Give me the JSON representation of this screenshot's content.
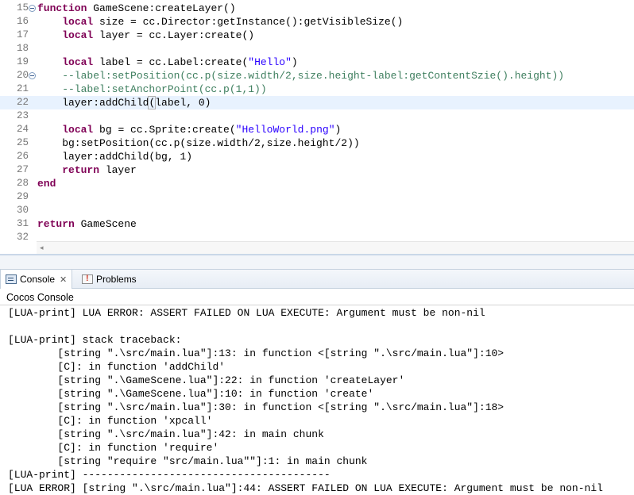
{
  "editor": {
    "lines": [
      {
        "num": "15",
        "fold": true,
        "tokens": [
          {
            "t": "function",
            "c": "kw"
          },
          {
            "t": " GameScene:createLayer()",
            "c": ""
          }
        ]
      },
      {
        "num": "16",
        "fold": false,
        "tokens": [
          {
            "t": "    ",
            "c": ""
          },
          {
            "t": "local",
            "c": "kw"
          },
          {
            "t": " size = cc.Director:getInstance():getVisibleSize()",
            "c": ""
          }
        ]
      },
      {
        "num": "17",
        "fold": false,
        "tokens": [
          {
            "t": "    ",
            "c": ""
          },
          {
            "t": "local",
            "c": "kw"
          },
          {
            "t": " layer = cc.Layer:create()",
            "c": ""
          }
        ]
      },
      {
        "num": "18",
        "fold": false,
        "tokens": []
      },
      {
        "num": "19",
        "fold": false,
        "tokens": [
          {
            "t": "    ",
            "c": ""
          },
          {
            "t": "local",
            "c": "kw"
          },
          {
            "t": " label = cc.Label:create(",
            "c": ""
          },
          {
            "t": "\"Hello\"",
            "c": "str"
          },
          {
            "t": ")",
            "c": ""
          }
        ]
      },
      {
        "num": "20",
        "fold": true,
        "tokens": [
          {
            "t": "    --label:setPosition(cc.p(size.width/2,size.height-label:getContentSzie().height))",
            "c": "cmt"
          }
        ]
      },
      {
        "num": "21",
        "fold": false,
        "tokens": [
          {
            "t": "    --label:setAnchorPoint(cc.p(1,1))",
            "c": "cmt"
          }
        ]
      },
      {
        "num": "22",
        "fold": false,
        "current": true,
        "tokens": [
          {
            "t": "    layer:addChild",
            "c": ""
          },
          {
            "t": "(",
            "c": "bracket"
          },
          {
            "t": "label, ",
            "c": ""
          },
          {
            "t": "0",
            "c": "num"
          },
          {
            "t": ")",
            "c": ""
          }
        ]
      },
      {
        "num": "23",
        "fold": false,
        "tokens": []
      },
      {
        "num": "24",
        "fold": false,
        "tokens": [
          {
            "t": "    ",
            "c": ""
          },
          {
            "t": "local",
            "c": "kw"
          },
          {
            "t": " bg = cc.Sprite:create(",
            "c": ""
          },
          {
            "t": "\"HelloWorld.png\"",
            "c": "str"
          },
          {
            "t": ")",
            "c": ""
          }
        ]
      },
      {
        "num": "25",
        "fold": false,
        "tokens": [
          {
            "t": "    bg:setPosition(cc.p(size.width/2,size.height/2))",
            "c": ""
          }
        ]
      },
      {
        "num": "26",
        "fold": false,
        "tokens": [
          {
            "t": "    layer:addChild(bg, ",
            "c": ""
          },
          {
            "t": "1",
            "c": "num"
          },
          {
            "t": ")",
            "c": ""
          }
        ]
      },
      {
        "num": "27",
        "fold": false,
        "tokens": [
          {
            "t": "    ",
            "c": ""
          },
          {
            "t": "return",
            "c": "kw"
          },
          {
            "t": " layer",
            "c": ""
          }
        ]
      },
      {
        "num": "28",
        "fold": false,
        "tokens": [
          {
            "t": "end",
            "c": "kw"
          }
        ]
      },
      {
        "num": "29",
        "fold": false,
        "tokens": []
      },
      {
        "num": "30",
        "fold": false,
        "tokens": []
      },
      {
        "num": "31",
        "fold": false,
        "tokens": [
          {
            "t": "return",
            "c": "kw"
          },
          {
            "t": " GameScene",
            "c": ""
          }
        ]
      },
      {
        "num": "32",
        "fold": false,
        "tokens": []
      }
    ],
    "scroll_arrow": "◂"
  },
  "tabs": {
    "console_label": "Console",
    "close_glyph": "✕",
    "problems_label": "Problems"
  },
  "console": {
    "title": "Cocos Console",
    "lines": [
      "[LUA-print] LUA ERROR: ASSERT FAILED ON LUA EXECUTE: Argument must be non-nil",
      "",
      "[LUA-print] stack traceback:",
      "        [string \".\\src/main.lua\"]:13: in function <[string \".\\src/main.lua\"]:10>",
      "        [C]: in function 'addChild'",
      "        [string \".\\GameScene.lua\"]:22: in function 'createLayer'",
      "        [string \".\\GameScene.lua\"]:10: in function 'create'",
      "        [string \".\\src/main.lua\"]:30: in function <[string \".\\src/main.lua\"]:18>",
      "        [C]: in function 'xpcall'",
      "        [string \".\\src/main.lua\"]:42: in main chunk",
      "        [C]: in function 'require'",
      "        [string \"require \"src/main.lua\"\"]:1: in main chunk",
      "[LUA-print] ----------------------------------------",
      "[LUA ERROR] [string \".\\src/main.lua\"]:44: ASSERT FAILED ON LUA EXECUTE: Argument must be non-nil"
    ]
  }
}
